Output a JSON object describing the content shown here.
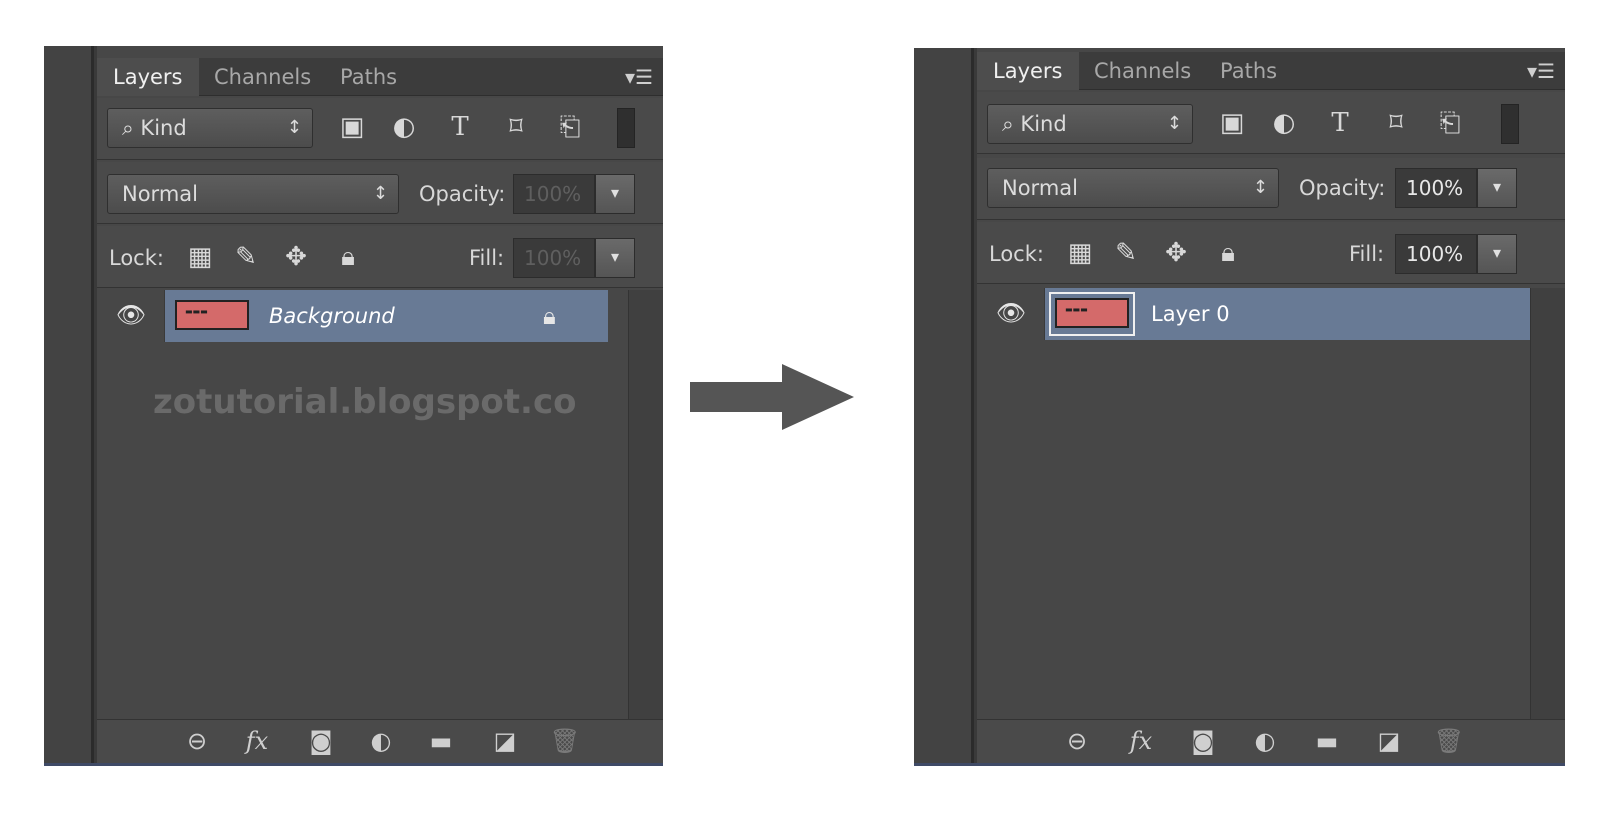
{
  "tabs": [
    "Layers",
    "Channels",
    "Paths"
  ],
  "panel_menu_icon": "panel-menu-icon",
  "filter": {
    "label": "⌕ Kind",
    "arrow": "↕"
  },
  "filter_icons": [
    "image-filter-icon",
    "adjustment-filter-icon",
    "type-filter-icon",
    "shape-filter-icon",
    "smart-object-filter-icon"
  ],
  "blend": {
    "value": "Normal",
    "arrow": "↕"
  },
  "opacity_label": "Opacity:",
  "fill_label": "Fill:",
  "lock_label": "Lock:",
  "percent": "100%",
  "left": {
    "layer_name": "Background",
    "watermark": "zotutorial.blogspot.co"
  },
  "right": {
    "layer_name": "Layer 0"
  },
  "footer_icons": [
    "link-layers-icon",
    "fx-icon",
    "layer-mask-icon",
    "adjustment-layer-icon",
    "group-folder-icon",
    "new-layer-icon",
    "trash-icon"
  ],
  "colors": {
    "panel": "#474747",
    "selected_layer": "#687a95",
    "arrow": "#555555"
  }
}
